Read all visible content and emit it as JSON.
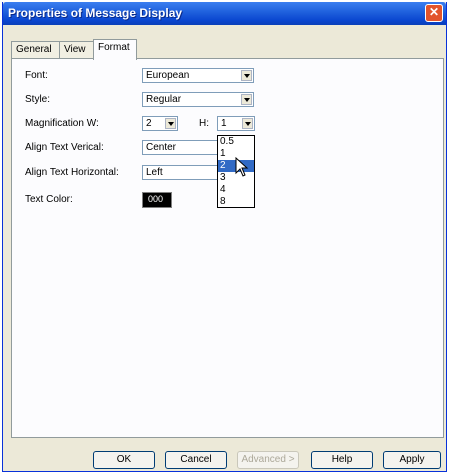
{
  "window": {
    "title": "Properties of Message Display",
    "close_label": "✕"
  },
  "tabs": [
    "General",
    "View",
    "Format"
  ],
  "form": {
    "font_label": "Font:",
    "font_value": "European",
    "style_label": "Style:",
    "style_value": "Regular",
    "magnification_label": "Magnification  W:",
    "w_value": "2",
    "h_label": "H:",
    "h_value": "1",
    "align_vertical_label": "Align Text Verical:",
    "align_vertical_value": "Center",
    "align_horizontal_label": "Align Text Horizontal:",
    "align_horizontal_value": "Left",
    "text_color_label": "Text Color:",
    "text_color_value": "000"
  },
  "dropdown_options": [
    "0.5",
    "1",
    "2",
    "3",
    "4",
    "8"
  ],
  "dropdown_selected": "2",
  "buttons": {
    "ok": "OK",
    "cancel": "Cancel",
    "advanced": "Advanced >",
    "help": "Help",
    "apply": "Apply"
  },
  "colors": {
    "titlebar": "#0a46d0",
    "selection": "#316ac5",
    "close_button": "#e2542c"
  }
}
